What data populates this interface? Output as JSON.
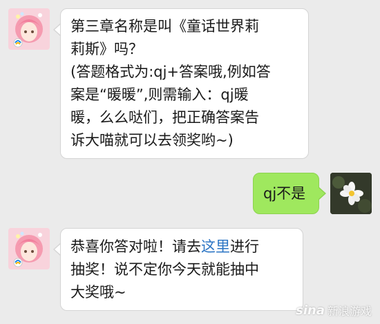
{
  "messages": [
    {
      "lines": [
        "第三章名称是叫《童话世界莉",
        "莉斯》吗？",
        "(答题格式为:qj+答案哦,例如答",
        "案是“暖暖”,则需输入：qj暖",
        "暖，么么哒们，把正确答案告",
        "诉大喵就可以去领奖哟~)"
      ]
    },
    {
      "text": "qj不是"
    },
    {
      "line1_before": "恭喜你答对啦！请去",
      "line1_link": "这里",
      "line1_after": "进行",
      "line2": "抽奖！说不定你今天就能抽中",
      "line3": "大奖哦~"
    }
  ],
  "watermark": {
    "logo": "sina",
    "text": "新浪游戏"
  },
  "colors": {
    "background": "#ebebeb",
    "outgoing_bubble": "#9fe85e",
    "link": "#2a74c4"
  }
}
